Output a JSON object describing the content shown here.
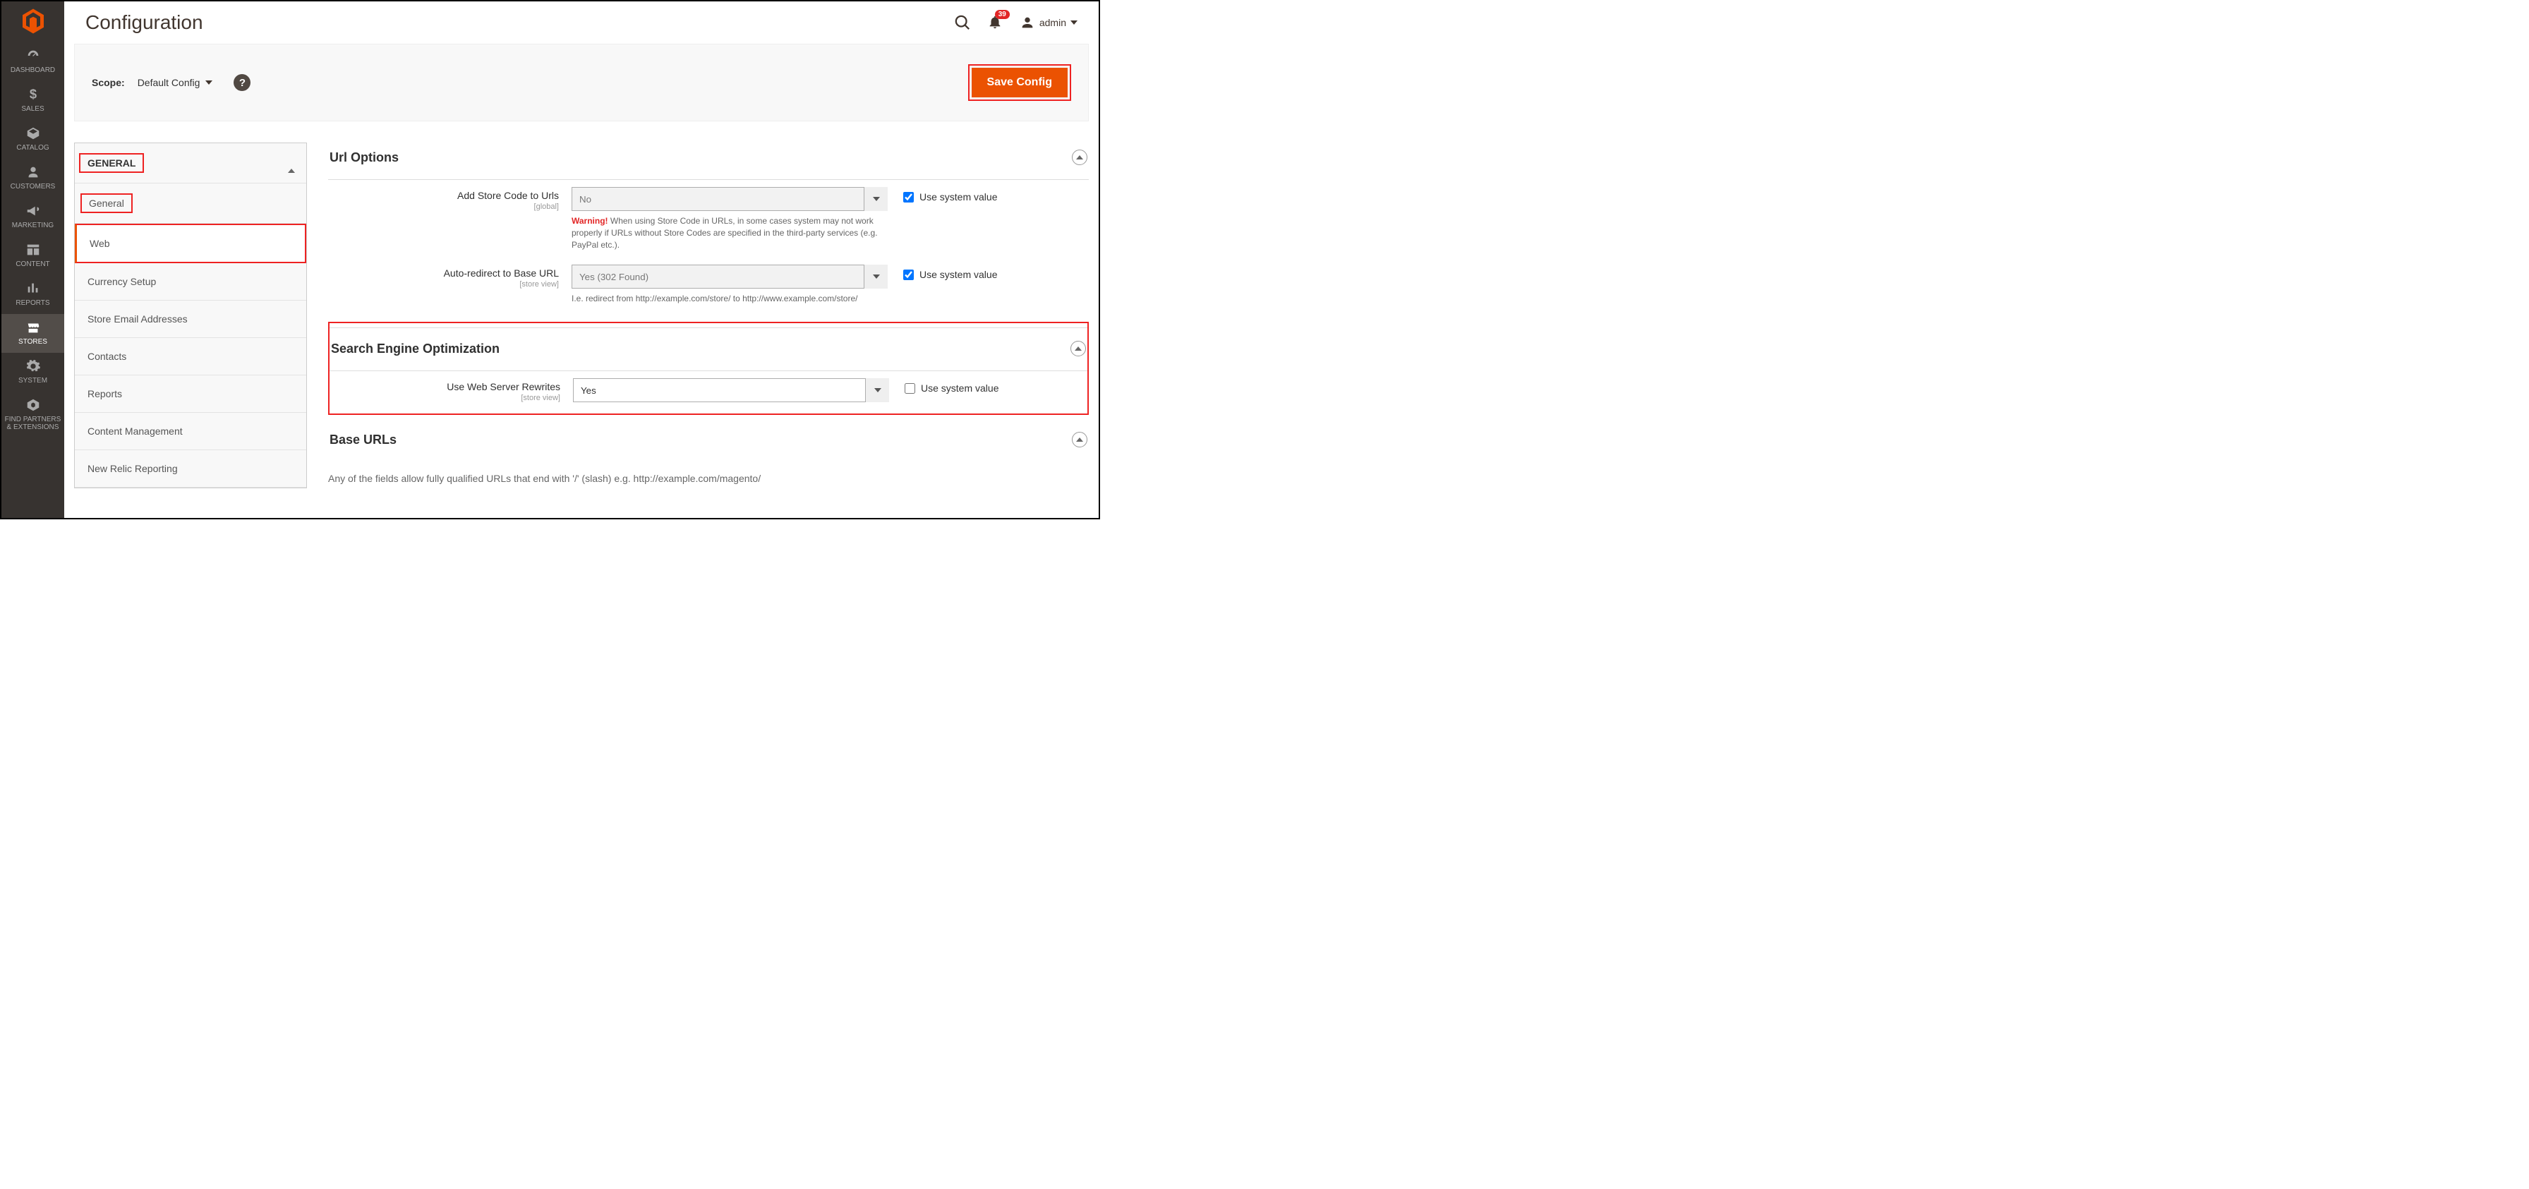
{
  "page": {
    "title": "Configuration"
  },
  "topbar": {
    "notification_count": "39",
    "username": "admin"
  },
  "scope": {
    "label": "Scope:",
    "value": "Default Config",
    "save_label": "Save Config"
  },
  "tabs": {
    "group_label": "GENERAL",
    "items": [
      {
        "label": "General"
      },
      {
        "label": "Web"
      },
      {
        "label": "Currency Setup"
      },
      {
        "label": "Store Email Addresses"
      },
      {
        "label": "Contacts"
      },
      {
        "label": "Reports"
      },
      {
        "label": "Content Management"
      },
      {
        "label": "New Relic Reporting"
      }
    ]
  },
  "nav": {
    "dashboard": "DASHBOARD",
    "sales": "SALES",
    "catalog": "CATALOG",
    "customers": "CUSTOMERS",
    "marketing": "MARKETING",
    "content": "CONTENT",
    "reports": "REPORTS",
    "stores": "STORES",
    "system": "SYSTEM",
    "partners_l1": "FIND PARTNERS",
    "partners_l2": "& EXTENSIONS"
  },
  "sections": {
    "url_options": {
      "title": "Url Options",
      "fields": {
        "add_store_code": {
          "label": "Add Store Code to Urls",
          "scope": "[global]",
          "value": "No",
          "sys_label": "Use system value",
          "warn_label": "Warning!",
          "warn_text": " When using Store Code in URLs, in some cases system may not work properly if URLs without Store Codes are specified in the third-party services (e.g. PayPal etc.)."
        },
        "auto_redirect": {
          "label": "Auto-redirect to Base URL",
          "scope": "[store view]",
          "value": "Yes (302 Found)",
          "sys_label": "Use system value",
          "note": "I.e. redirect from http://example.com/store/ to http://www.example.com/store/"
        }
      }
    },
    "seo": {
      "title": "Search Engine Optimization",
      "fields": {
        "rewrites": {
          "label": "Use Web Server Rewrites",
          "scope": "[store view]",
          "value": "Yes",
          "sys_label": "Use system value"
        }
      }
    },
    "base_urls": {
      "title": "Base URLs",
      "note": "Any of the fields allow fully qualified URLs that end with '/' (slash) e.g. http://example.com/magento/"
    }
  }
}
